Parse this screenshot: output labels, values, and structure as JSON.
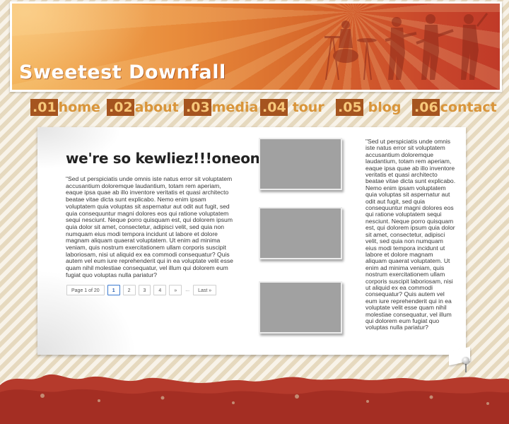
{
  "site": {
    "title": "Sweetest Downfall"
  },
  "nav": [
    {
      "num": ".01",
      "label": "home"
    },
    {
      "num": ".02",
      "label": "about"
    },
    {
      "num": ".03",
      "label": "media"
    },
    {
      "num": ".04",
      "label": "tour"
    },
    {
      "num": ".05",
      "label": "blog"
    },
    {
      "num": ".06",
      "label": "contact"
    }
  ],
  "post": {
    "title": "we're so kewliez!!!oneone",
    "body": "\"Sed ut perspiciatis unde omnis iste natus error sit voluptatem accusantium doloremque laudantium, totam rem aperiam, eaque ipsa quae ab illo inventore veritatis et quasi architecto beatae vitae dicta sunt explicabo. Nemo enim ipsam voluptatem quia voluptas sit aspernatur aut odit aut fugit, sed quia consequuntur magni dolores eos qui ratione voluptatem sequi nesciunt. Neque porro quisquam est, qui dolorem ipsum quia dolor sit amet, consectetur, adipisci velit, sed quia non numquam eius modi tempora incidunt ut labore et dolore magnam aliquam quaerat voluptatem. Ut enim ad minima veniam, quis nostrum exercitationem ullam corporis suscipit laboriosam, nisi ut aliquid ex ea commodi consequatur? Quis autem vel eum iure reprehenderit qui in ea voluptate velit esse quam nihil molestiae consequatur, vel illum qui dolorem eum fugiat quo voluptas nulla pariatur?"
  },
  "pager": {
    "info": "Page 1 of 20",
    "pages": [
      "1",
      "2",
      "3",
      "4"
    ],
    "next": "»",
    "dots": "...",
    "last": "Last »"
  },
  "sidebar": {
    "text": "\"Sed ut perspiciatis unde omnis iste natus error sit voluptatem accusantium doloremque laudantium, totam rem aperiam, eaque ipsa quae ab illo inventore veritatis et quasi architecto beatae vitae dicta sunt explicabo. Nemo enim ipsam voluptatem quia voluptas sit aspernatur aut odit aut fugit, sed quia consequuntur magni dolores eos qui ratione voluptatem sequi nesciunt. Neque porro quisquam est, qui dolorem ipsum quia dolor sit amet, consectetur, adipisci velit, sed quia non numquam eius modi tempora incidunt ut labore et dolore magnam aliquam quaerat voluptatem. Ut enim ad minima veniam, quis nostrum exercitationem ullam corporis suscipit laboriosam, nisi ut aliquid ex ea commodi consequatur? Quis autem vel eum iure reprehenderit qui in ea voluptate velit esse quam nihil molestiae consequatur, vel illum qui dolorem eum fugiat quo voluptas nulla pariatur?"
  },
  "colors": {
    "banner_left": "#f3b35a",
    "banner_right": "#c03a28",
    "nav_text": "#d9953a",
    "nav_number_bg": "#a5541f",
    "footer_red": "#b53a2c",
    "thumb_grey": "#a1a1a1"
  },
  "icons": [
    "band-silhouette-icon",
    "pushpin-icon"
  ]
}
